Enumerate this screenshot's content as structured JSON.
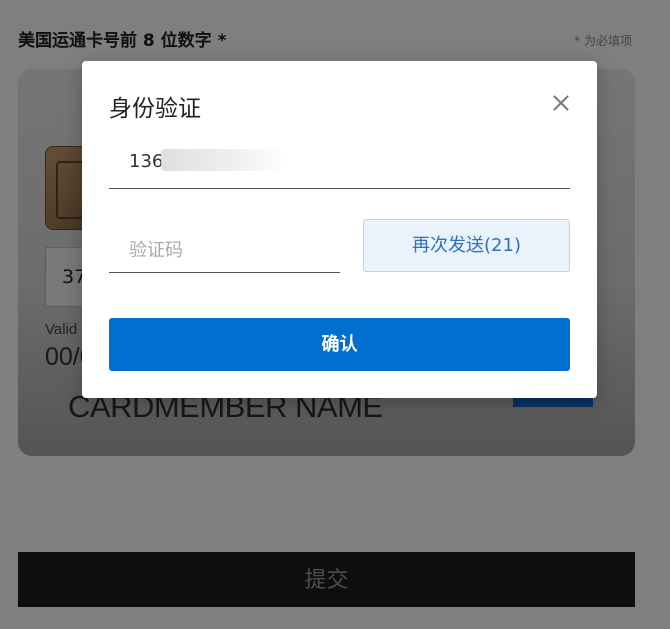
{
  "page": {
    "field_label": "美国运通卡号前 8 位数字 *",
    "required_note": "* 为必填项",
    "submit_label": "提交"
  },
  "card": {
    "number_partial": "37",
    "valid_label": "Valid",
    "valid_value": "00/0",
    "cardmember_name": "CARDMEMBER NAME"
  },
  "modal": {
    "title": "身份验证",
    "phone_visible": "136",
    "code_placeholder": "验证码",
    "resend_label": "再次发送(21)",
    "confirm_label": "确认"
  },
  "icons": {
    "close": "close-icon"
  },
  "colors": {
    "primary": "#006fcf",
    "resend_bg": "#eaf3fc",
    "resend_text": "#2f6fbe",
    "overlay": "rgba(0,0,0,0.5)",
    "submit_bg": "#1d1d1d"
  }
}
